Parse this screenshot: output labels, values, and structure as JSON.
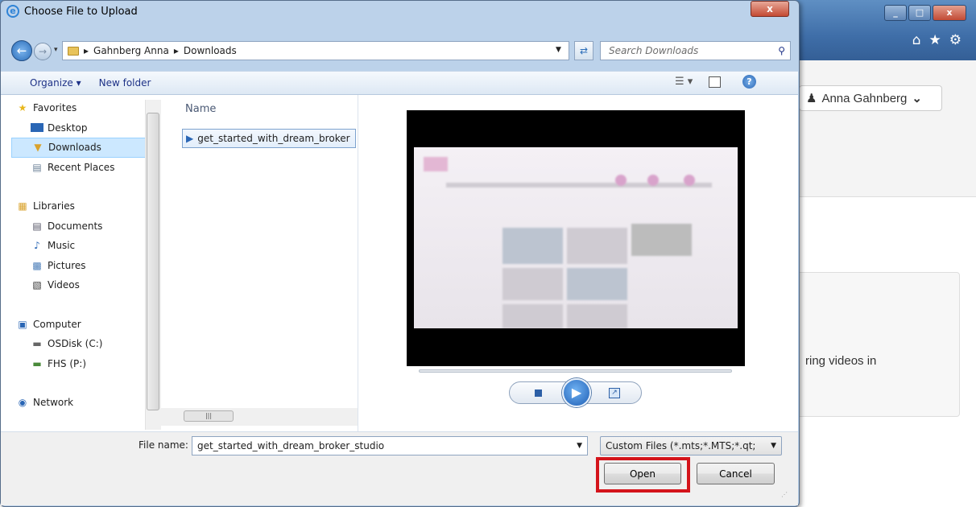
{
  "browser": {
    "user_menu_label": "Anna Gahnberg",
    "card_text": "ring videos in",
    "window_controls": [
      "_",
      "□",
      "x"
    ],
    "toolbar_icons": [
      "home-icon",
      "star-icon",
      "gear-icon"
    ]
  },
  "dialog": {
    "title": "Choose File to Upload",
    "close_label": "x",
    "breadcrumb": [
      "Gahnberg Anna",
      "Downloads"
    ],
    "search_placeholder": "Search Downloads",
    "toolbar": {
      "organize_label": "Organize ▾",
      "new_folder_label": "New folder"
    },
    "nav": {
      "favorites_label": "Favorites",
      "favorites_items": [
        "Desktop",
        "Downloads",
        "Recent Places"
      ],
      "selected_item": "Downloads",
      "libraries_label": "Libraries",
      "libraries_items": [
        "Documents",
        "Music",
        "Pictures",
        "Videos"
      ],
      "computer_label": "Computer",
      "computer_items": [
        "OSDisk (C:)",
        "FHS (P:)"
      ],
      "network_label": "Network"
    },
    "file_list": {
      "column_header": "Name",
      "files": [
        "get_started_with_dream_broker"
      ]
    },
    "filename_label": "File name:",
    "filename_value": "get_started_with_dream_broker_studio",
    "filetype_value": "Custom Files (*.mts;*.MTS;*.qt;",
    "open_label": "Open",
    "cancel_label": "Cancel"
  },
  "colors": {
    "highlight": "#d4141b",
    "selection": "#cce8ff",
    "title_bar": "#bcd2ea"
  }
}
